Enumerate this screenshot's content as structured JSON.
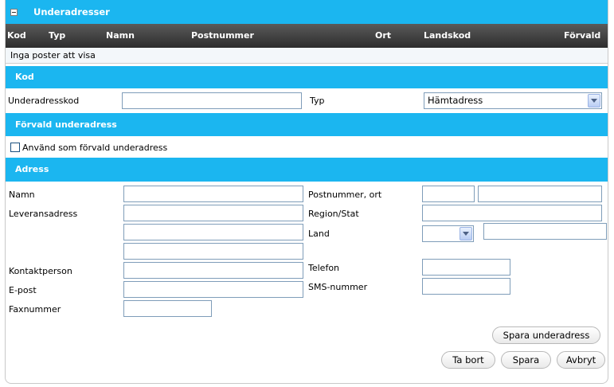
{
  "header": {
    "title": "Underadresser"
  },
  "table": {
    "columns": [
      "Kod",
      "Typ",
      "Namn",
      "Postnummer",
      "Ort",
      "Landskod",
      "Förvald"
    ],
    "empty_text": "Inga poster att visa"
  },
  "sections": {
    "kod": "Kod",
    "forvald": "Förvald underadress",
    "adress": "Adress"
  },
  "kod_section": {
    "underadresskod_label": "Underadresskod",
    "underadresskod_value": "",
    "typ_label": "Typ",
    "typ_value": "Hämtadress"
  },
  "forvald_section": {
    "checkbox_label": "Använd som förvald underadress"
  },
  "adress_section": {
    "namn_label": "Namn",
    "leveransadress_label": "Leveransadress",
    "kontaktperson_label": "Kontaktperson",
    "epost_label": "E-post",
    "faxnummer_label": "Faxnummer",
    "postnummer_ort_label": "Postnummer, ort",
    "region_label": "Region/Stat",
    "land_label": "Land",
    "telefon_label": "Telefon",
    "sms_label": "SMS-nummer"
  },
  "buttons": {
    "spara_underadress": "Spara underadress",
    "ta_bort": "Ta bort",
    "spara": "Spara",
    "avbryt": "Avbryt"
  },
  "colors": {
    "band": "#1bb6f0",
    "table_header": "#3a3a3a"
  }
}
